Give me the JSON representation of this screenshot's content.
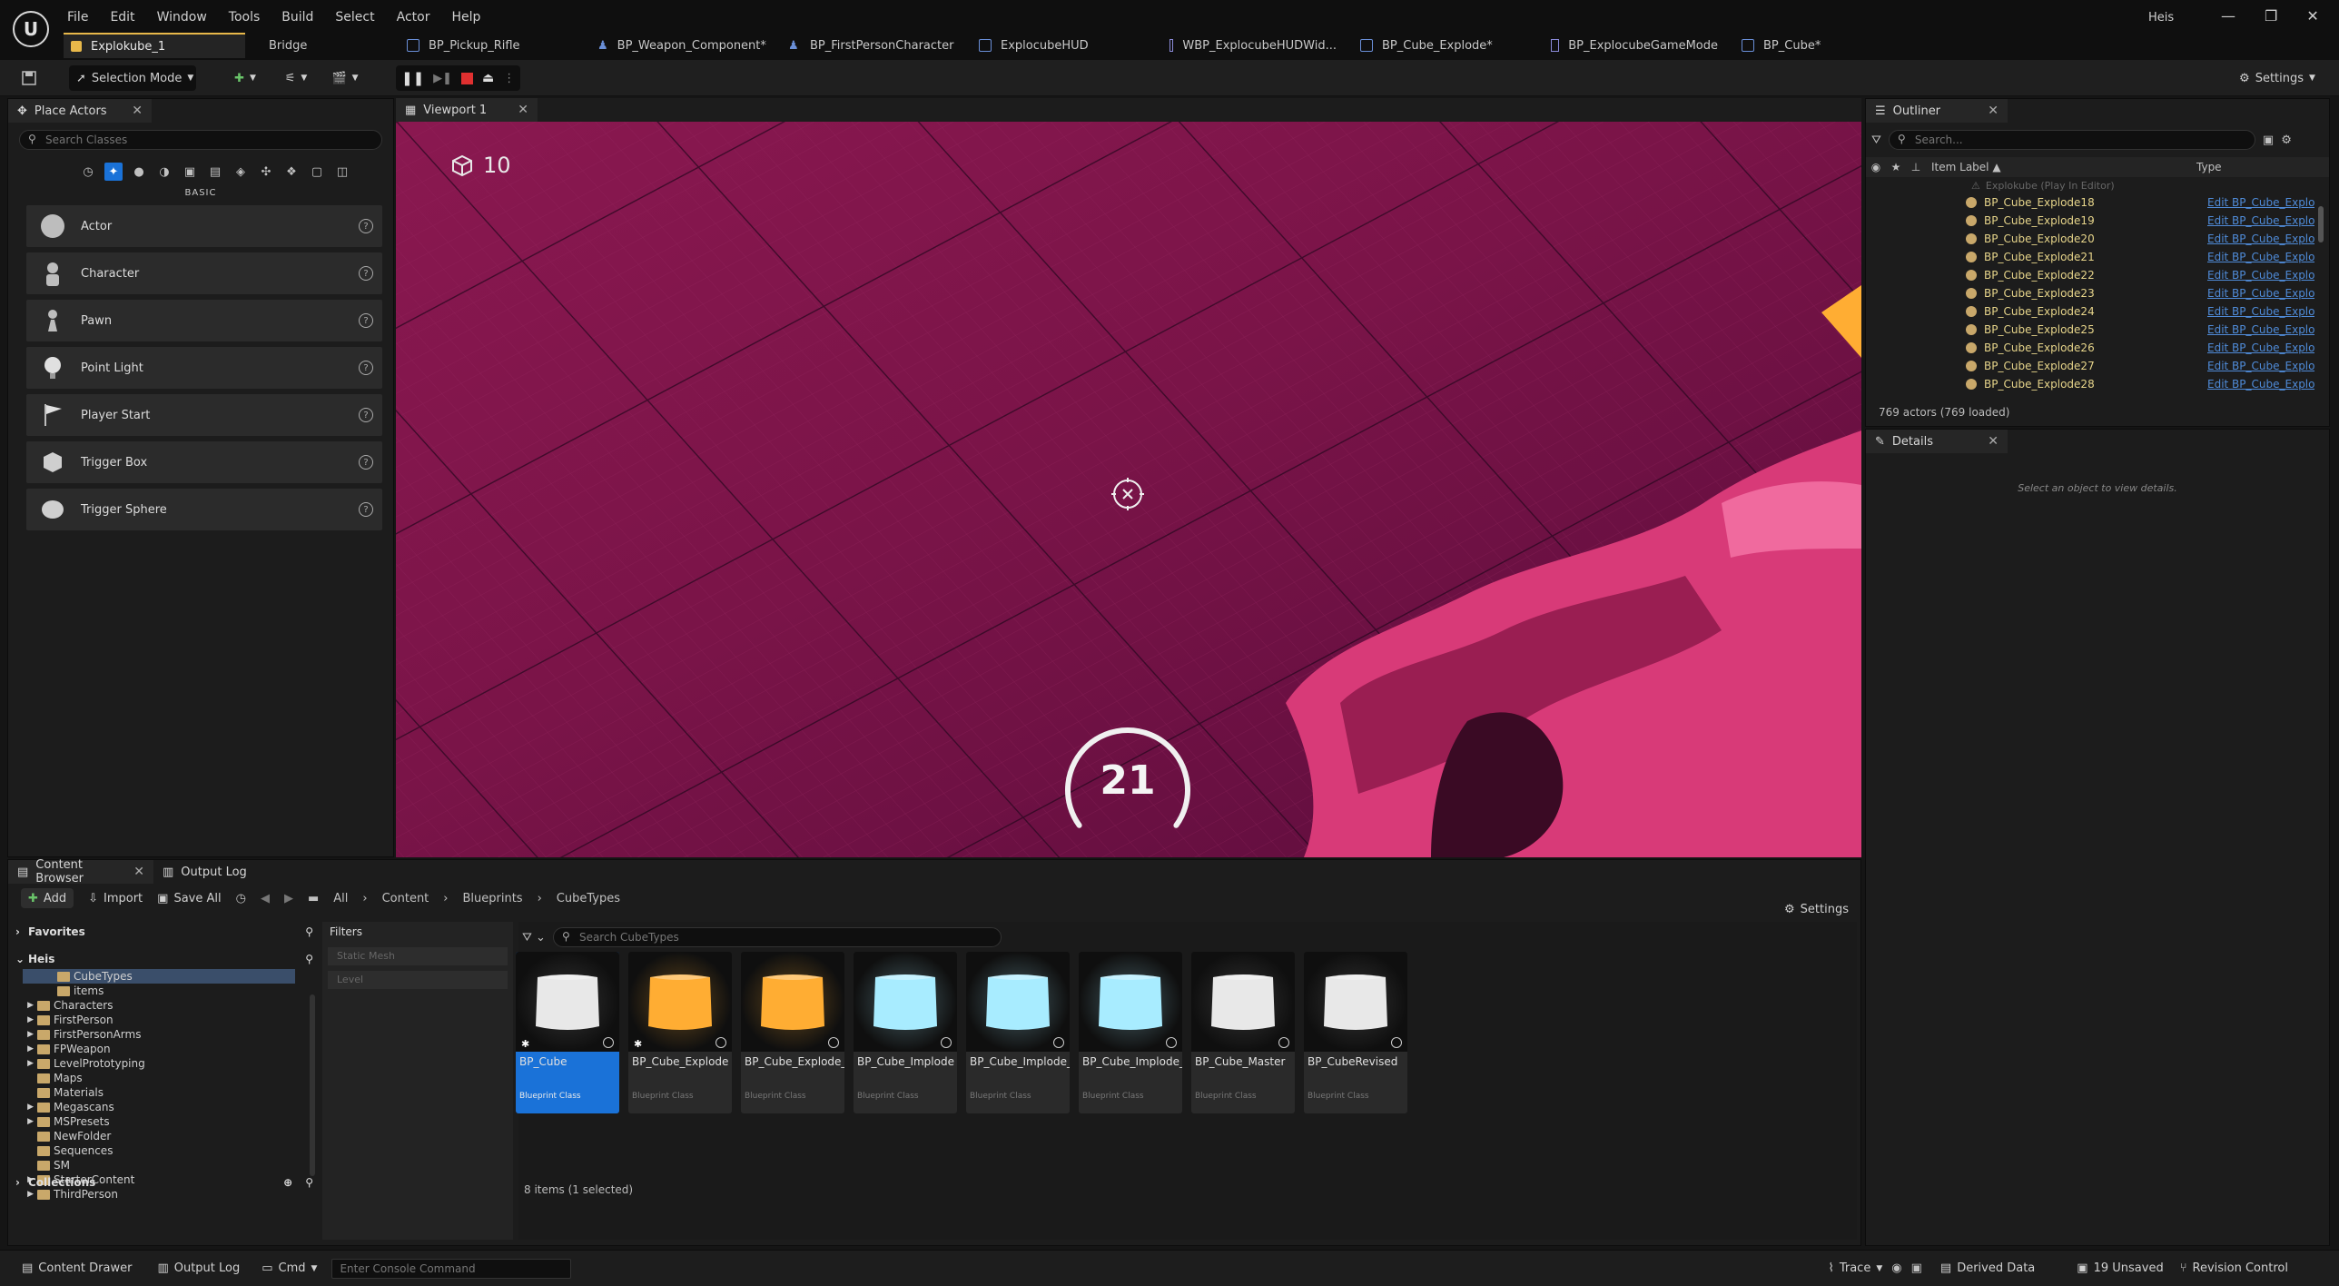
{
  "app": {
    "logo": "unreal-engine-logo",
    "user": "Heis"
  },
  "menu": [
    "File",
    "Edit",
    "Window",
    "Tools",
    "Build",
    "Select",
    "Actor",
    "Help"
  ],
  "doc_tabs": [
    {
      "label": "Explokube_1",
      "icon": "level-icon"
    },
    {
      "label": "Bridge",
      "icon": "bridge-icon"
    },
    {
      "label": "BP_Pickup_Rifle",
      "icon": "blueprint-icon"
    },
    {
      "label": "BP_Weapon_Component*",
      "icon": "person-icon"
    },
    {
      "label": "BP_FirstPersonCharacter",
      "icon": "person-icon"
    },
    {
      "label": "ExplocubeHUD",
      "icon": "blueprint-icon"
    },
    {
      "label": "WBP_ExplocubeHUDWid...",
      "icon": "widget-icon"
    },
    {
      "label": "BP_Cube_Explode*",
      "icon": "blueprint-icon"
    },
    {
      "label": "BP_ExplocubeGameMode",
      "icon": "widget-icon"
    },
    {
      "label": "BP_Cube*",
      "icon": "blueprint-icon"
    }
  ],
  "toolbar": {
    "mode": "Selection Mode",
    "settings": "Settings"
  },
  "place_actors": {
    "tab": "Place Actors",
    "search_placeholder": "Search Classes",
    "category": "BASIC",
    "items": [
      "Actor",
      "Character",
      "Pawn",
      "Point Light",
      "Player Start",
      "Trigger Box",
      "Trigger Sphere"
    ]
  },
  "viewport": {
    "tab": "Viewport 1",
    "cube_count": "10",
    "timer": "21",
    "timer_progress": 0.6
  },
  "outliner": {
    "tab": "Outliner",
    "search_placeholder": "Search...",
    "col_label": "Item Label ▲",
    "col_type": "Type",
    "root": "Explokube (Play In Editor)",
    "rows": [
      {
        "name": "BP_Cube_Explode18",
        "type": "Edit BP_Cube_Explo"
      },
      {
        "name": "BP_Cube_Explode19",
        "type": "Edit BP_Cube_Explo"
      },
      {
        "name": "BP_Cube_Explode20",
        "type": "Edit BP_Cube_Explo"
      },
      {
        "name": "BP_Cube_Explode21",
        "type": "Edit BP_Cube_Explo"
      },
      {
        "name": "BP_Cube_Explode22",
        "type": "Edit BP_Cube_Explo"
      },
      {
        "name": "BP_Cube_Explode23",
        "type": "Edit BP_Cube_Explo"
      },
      {
        "name": "BP_Cube_Explode24",
        "type": "Edit BP_Cube_Explo"
      },
      {
        "name": "BP_Cube_Explode25",
        "type": "Edit BP_Cube_Explo"
      },
      {
        "name": "BP_Cube_Explode26",
        "type": "Edit BP_Cube_Explo"
      },
      {
        "name": "BP_Cube_Explode27",
        "type": "Edit BP_Cube_Explo"
      },
      {
        "name": "BP_Cube_Explode28",
        "type": "Edit BP_Cube_Explo"
      }
    ],
    "count": "769 actors (769 loaded)"
  },
  "details": {
    "tab": "Details",
    "empty": "Select an object to view details."
  },
  "content_browser": {
    "tab": "Content Browser",
    "output_tab": "Output Log",
    "add": "Add",
    "import": "Import",
    "save_all": "Save All",
    "breadcrumb": [
      "All",
      "Content",
      "Blueprints",
      "CubeTypes"
    ],
    "settings": "Settings",
    "favorites": "Favorites",
    "root": "Heis",
    "tree": [
      "CubeTypes",
      "items",
      "Characters",
      "FirstPerson",
      "FirstPersonArms",
      "FPWeapon",
      "LevelPrototyping",
      "Maps",
      "Materials",
      "Megascans",
      "MSPresets",
      "NewFolder",
      "Sequences",
      "SM",
      "StarterContent",
      "ThirdPerson"
    ],
    "collections": "Collections",
    "filters_label": "Filters",
    "filters": [
      "Static Mesh",
      "Level"
    ],
    "search_placeholder": "Search CubeTypes",
    "assets": [
      {
        "name": "BP_Cube",
        "cls": "Blueprint Class",
        "color": "#e8e8e8"
      },
      {
        "name": "BP_Cube_Explode",
        "cls": "Blueprint Class",
        "color": "#ffad33"
      },
      {
        "name": "BP_Cube_Explode_More",
        "cls": "Blueprint Class",
        "color": "#ffad33"
      },
      {
        "name": "BP_Cube_Implode",
        "cls": "Blueprint Class",
        "color": "#a8ecff"
      },
      {
        "name": "BP_Cube_Implode_More",
        "cls": "Blueprint Class",
        "color": "#a8ecff"
      },
      {
        "name": "BP_Cube_Implode_More_More",
        "cls": "Blueprint Class",
        "color": "#a8ecff"
      },
      {
        "name": "BP_Cube_Master",
        "cls": "Blueprint Class",
        "color": "#e8e8e8"
      },
      {
        "name": "BP_CubeRevised",
        "cls": "Blueprint Class",
        "color": "#e8e8e8"
      }
    ],
    "count": "8 items (1 selected)"
  },
  "status": {
    "drawer": "Content Drawer",
    "output": "Output Log",
    "cmd": "Cmd",
    "console_placeholder": "Enter Console Command",
    "trace": "Trace",
    "derived": "Derived Data",
    "unsaved": "19 Unsaved",
    "revision": "Revision Control"
  }
}
